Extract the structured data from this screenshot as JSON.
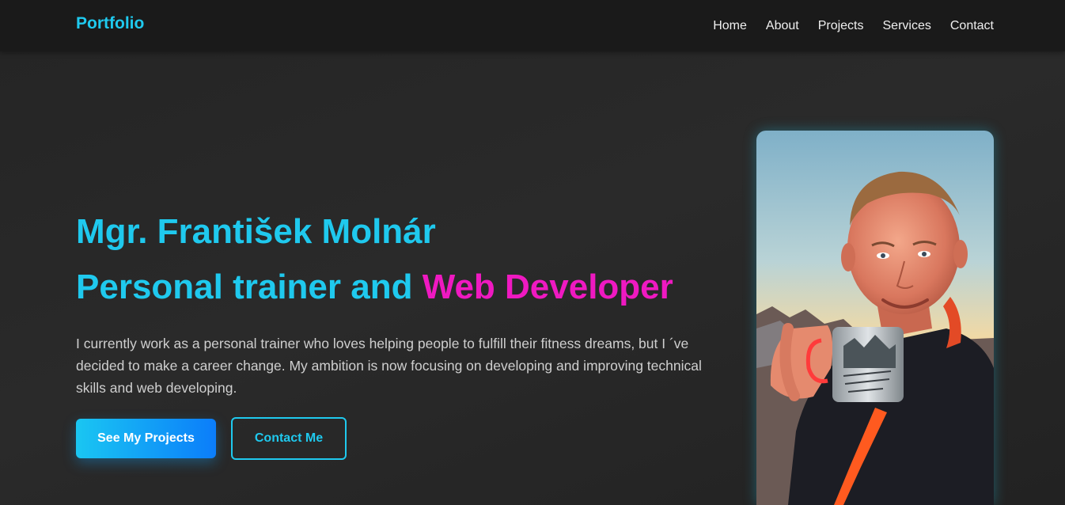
{
  "nav": {
    "logo": "Portfolio",
    "links": [
      "Home",
      "About",
      "Projects",
      "Services",
      "Contact"
    ]
  },
  "hero": {
    "name": "Mgr. František Molnár",
    "role_main": "Personal trainer and ",
    "role_accent": "Web Developer",
    "intro": "I currently work as a personal trainer who loves helping people to fulfill their fitness dreams, but I ´ve decided to make a career change. My ambition is now focusing on developing and improving technical skills and web developing.",
    "primary_button": "See My Projects",
    "secondary_button": "Contact Me"
  },
  "photo": {
    "subject": "portrait of a smiling man holding a mug at sunrise on a mountain"
  },
  "colors": {
    "accent_cyan": "#1fc9ee",
    "accent_magenta": "#ef19c1",
    "background": "#252525",
    "navbar": "#1a1a1a",
    "button_gradient_start": "#1ac6f2",
    "button_gradient_end": "#0b7dfa"
  }
}
